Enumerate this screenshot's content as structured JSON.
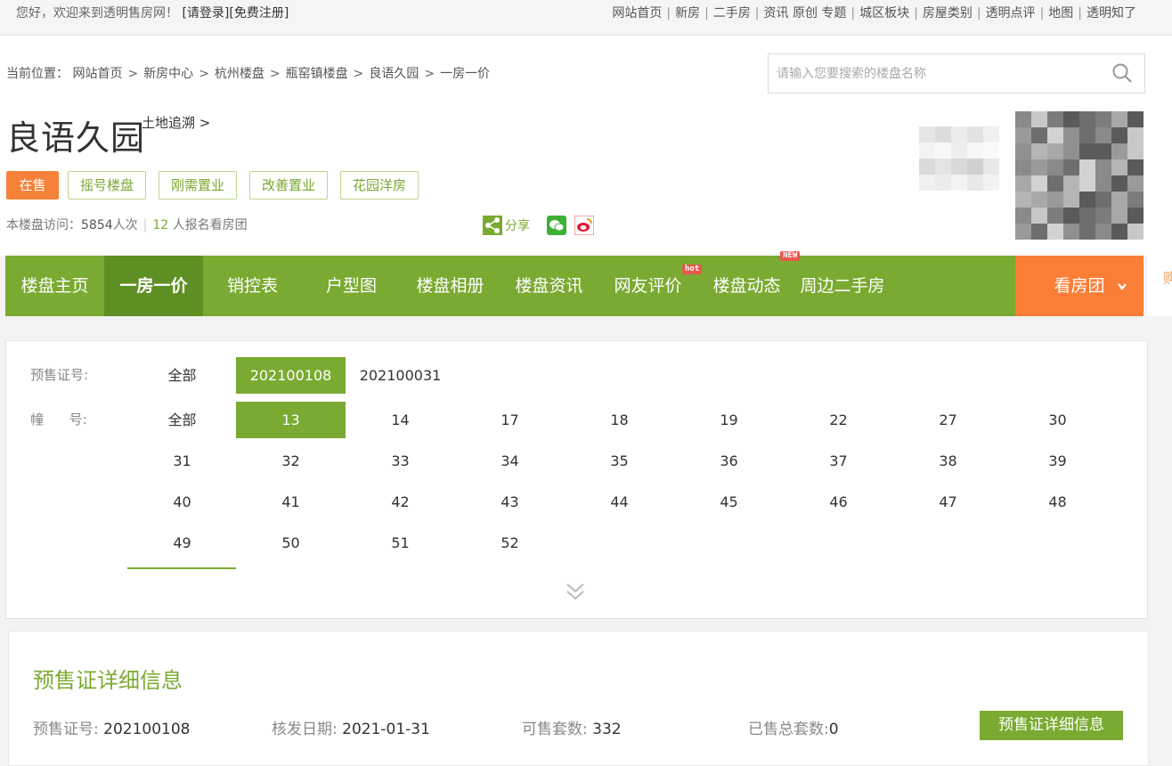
{
  "topbar": {
    "greeting": "您好，欢迎来到透明售房网！",
    "login": "[请登录]",
    "register": "[免费注册]",
    "links": [
      "网站首页",
      "新房",
      "二手房",
      "资讯 原创 专题",
      "城区板块",
      "房屋类别",
      "透明点评",
      "地图",
      "透明知了"
    ]
  },
  "breadcrumb": {
    "prefix": "当前位置：",
    "items": [
      "网站首页",
      "新房中心",
      "杭州楼盘",
      "瓶窑镇楼盘",
      "良语久园",
      "一房一价"
    ],
    "sep": ">"
  },
  "search": {
    "placeholder": "请输入您要搜索的楼盘名称",
    "icon": "search-icon"
  },
  "project": {
    "name": "良语久园",
    "trace_link": "土地追溯 >",
    "status_tag": "在售",
    "tags": [
      "摇号楼盘",
      "刚需置业",
      "改善置业",
      "花园洋房"
    ],
    "visits_label": "本楼盘访问：",
    "visits_count": "5854",
    "visits_unit": "人次",
    "signup_count": "12",
    "signup_text": " 人报名看房团",
    "share_label": "分享"
  },
  "nav": {
    "items": [
      "楼盘主页",
      "一房一价",
      "销控表",
      "户型图",
      "楼盘相册",
      "楼盘资讯",
      "网友评价",
      "楼盘动态",
      "周边二手房"
    ],
    "active_index": 1,
    "badges": {
      "hot": "hot",
      "new": "NEW"
    },
    "tour_label": "看房团",
    "corner_char": "购"
  },
  "filters": {
    "presale_label": "预售证号:",
    "presale_options": [
      "全部",
      "202100108",
      "202100031"
    ],
    "presale_selected": "202100108",
    "building_label": "幢      号:",
    "building_all": "全部",
    "buildings": [
      "13",
      "14",
      "17",
      "18",
      "19",
      "22",
      "27",
      "30",
      "31",
      "32",
      "33",
      "34",
      "35",
      "36",
      "37",
      "38",
      "39",
      "40",
      "41",
      "42",
      "43",
      "44",
      "45",
      "46",
      "47",
      "48",
      "49",
      "50",
      "51",
      "52"
    ],
    "building_selected": "13"
  },
  "detail": {
    "title": "预售证详细信息",
    "fields": [
      {
        "label": "预售证号:",
        "value": "202100108"
      },
      {
        "label": "核发日期:",
        "value": "2021-01-31"
      },
      {
        "label": "可售套数:",
        "value": "332"
      },
      {
        "label": "已售总套数:",
        "value": "0"
      }
    ],
    "button": "预售证详细信息"
  },
  "colors": {
    "brand_green": "#7aaa31",
    "active_green": "#5e8f22",
    "orange": "#fb7e36",
    "sale_orange": "#f6823a"
  }
}
